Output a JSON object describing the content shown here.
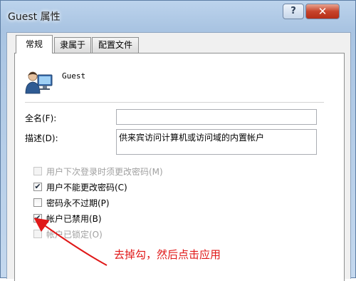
{
  "window": {
    "title": "Guest 属性",
    "help_label": "?",
    "close_label": "✕"
  },
  "tabs": [
    {
      "label": "常规",
      "active": true
    },
    {
      "label": "隶属于",
      "active": false
    },
    {
      "label": "配置文件",
      "active": false
    }
  ],
  "general": {
    "username": "Guest",
    "full_name_label": "全名(F):",
    "full_name_value": "",
    "description_label": "描述(D):",
    "description_value": "供来宾访问计算机或访问域的内置帐户",
    "checkboxes": [
      {
        "label": "用户下次登录时须更改密码(M)",
        "checked": false,
        "enabled": false
      },
      {
        "label": "用户不能更改密码(C)",
        "checked": true,
        "enabled": true
      },
      {
        "label": "密码永不过期(P)",
        "checked": false,
        "enabled": true
      },
      {
        "label": "帐户已禁用(B)",
        "checked": true,
        "enabled": true
      },
      {
        "label": "帐户已锁定(O)",
        "checked": false,
        "enabled": false
      }
    ]
  },
  "annotation": {
    "text": "去掉勾，然后点击应用",
    "color": "#e01818"
  },
  "colors": {
    "close_button": "#c7432b",
    "title_glass": "#a9c4e2"
  }
}
